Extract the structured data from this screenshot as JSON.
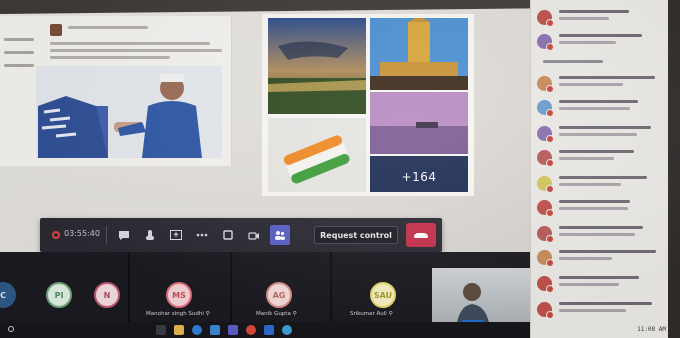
{
  "window": {
    "app": "Microsoft Teams meeting"
  },
  "gallery": {
    "more_count": "+164"
  },
  "call_controls": {
    "timer": "03:55:40",
    "request_control_label": "Request control",
    "buttons": [
      "record-icon",
      "chat-icon",
      "raise-hand-icon",
      "share-icon",
      "more-icon",
      "camera-icon",
      "mic-icon",
      "people-icon"
    ]
  },
  "participants": [
    {
      "initials": "C",
      "name": "",
      "color": "#2d5a87"
    },
    {
      "initials": "PI",
      "name": "",
      "color": "#6fa67a"
    },
    {
      "initials": "N",
      "name": "",
      "color": "#c05a6e"
    },
    {
      "initials": "MS",
      "name": "Manohar singh Sudhi  ⚲",
      "color": "#e0707b"
    },
    {
      "initials": "AG",
      "name": "Manik Gupta  ⚲",
      "color": "#d88f88"
    },
    {
      "initials": "SAU",
      "name": "Srikumar Auli  ⚲",
      "color": "#e2d76b"
    }
  ],
  "people_panel": {
    "avatar_colors": [
      "#c04f4a",
      "#8a6fae",
      "#c78a58",
      "#6b9bd0",
      "#8a6fae",
      "#b85a5a",
      "#d4c45e",
      "#c04f4a",
      "#b85a5a",
      "#c78a58",
      "#c04f4a",
      "#c04f4a"
    ]
  },
  "taskbar": {
    "clock": "11:08 AM"
  }
}
